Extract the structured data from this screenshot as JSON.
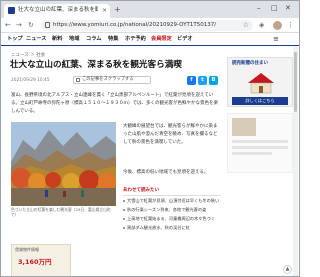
{
  "browser": {
    "tab_title": "壮大な立山の紅葉、深まる秋を観光客ら",
    "url": "https://www.yomiuri.co.jp/national/20210929-OYT1T50137/",
    "win_minimize": "–",
    "win_maximize": "□",
    "win_close": "✕",
    "new_tab": "+",
    "tab_close": "×"
  },
  "site_nav": {
    "items": [
      "トップ",
      "ニュース",
      "新料",
      "地域",
      "コラム",
      "特集",
      "ホテ予約",
      "会員限定",
      "ビデオ"
    ],
    "active_index": 7,
    "menu_glyph": "≡"
  },
  "article": {
    "breadcrumb": "ニュース ＞ 社会",
    "headline": "壮大な立山の紅葉、深まる秋を観光客ら満喫",
    "date": "2021/09/29 10:45",
    "clip_label": "この記事をスクラップする",
    "share": [
      "f",
      "t",
      "B"
    ],
    "lead": "富山、長野県境の北アルプス・立山連峰を貫く「立山黒部アルペンルート」で紅葉が見頃を迎えている。立山町芦峅寺の弥陀ヶ原（標高１５１０～１９３０ｍ）では、多くの観光客が色鮮やかな景色を楽しんでいる。",
    "caption": "色づいた立山の紅葉を楽しむ観光客（29日、富山県立山町で）",
    "body2": "大観峰の展望台では、観光客らが鮮やかに染まった山肌や澄んだ青空を眺め、写真を撮るなどして秋の景色を満喫していた。",
    "body3": "今後、標高の低い地域でも見頃を迎える。",
    "related_heading": "あわせて読みたい",
    "related_items": [
      "大雪山で紅葉が見頃、山頂付近は早くも冬の装い",
      "秋の行楽シーズン到来、各地で観光客の姿",
      "上高地で紅葉始まる、河童橋周辺の木々色づく",
      "黒部ダム観光放水、秋の渓谷に虹"
    ]
  },
  "ads": {
    "side_brand": "読売新聞の住まい",
    "side_cta": "詳しくはこちら",
    "bottom_label": "賃貸物件情報",
    "bottom_price": "3,160万円"
  },
  "back_to_top": "▲",
  "colors": {
    "brand_blue": "#1a3d8f",
    "accent_red": "#c8161e"
  }
}
